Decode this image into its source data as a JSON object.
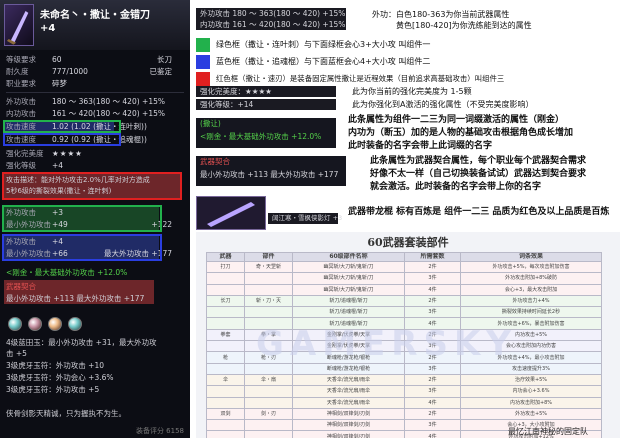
{
  "card": {
    "name": "未命名丶・撒让・金错刀",
    "level": "+4",
    "rows": [
      {
        "k": "等级要求",
        "v": "60",
        "r": "长刀"
      },
      {
        "k": "耐久度",
        "v": "777/1000",
        "r": "已鉴定"
      },
      {
        "k": "职业要求",
        "v": "碎梦",
        "r": ""
      },
      {
        "k": "外功攻击",
        "v": "180 ～ 363(180 ～ 420) +15%",
        "r": ""
      },
      {
        "k": "内功攻击",
        "v": "161 ～ 420(180 ～ 420) +15%",
        "r": ""
      },
      {
        "k": "攻击速度",
        "v": "1.02 (1.02 (撒让・连叶刺))",
        "r": ""
      },
      {
        "k": "攻击速度",
        "v": "0.92 (0.92 (撒让・追魂棍))",
        "r": ""
      },
      {
        "k": "强化完美度",
        "v": "★★★★",
        "r": ""
      },
      {
        "k": "强化等级",
        "v": "+4",
        "r": ""
      }
    ],
    "attack_note": "攻击描述：能对外功攻击2.0%几率对对方造成",
    "attack_note_2": "5秒6级的撕裂效果(撒让・连叶刺)",
    "green_block": [
      {
        "k": "外功攻击",
        "v": "+3",
        "r": ""
      },
      {
        "k": "最小外功攻击",
        "v": "+49",
        "r": "+122"
      }
    ],
    "blue_block": [
      {
        "k": "外功攻击",
        "v": "+4",
        "r": ""
      },
      {
        "k": "最小外功攻击",
        "v": "+66",
        "r": "最大外功攻击 +177"
      }
    ],
    "crest_header": "<刚金・最大基础外功攻击 +12.0%",
    "crest_label": "武器契合",
    "crest_row": "最小外功攻击 +113   最大外功攻击 +177",
    "gem_lines": [
      "4级蓝田玉：最小外功攻击 +31，最大外功攻",
      "击 +5",
      "3级虎牙玉符：外功攻击 +10",
      "3级虎牙玉符：外功会心 +3.6%",
      "3级虎牙玉符：外功攻击 +5"
    ],
    "flavor": "侠骨剑影天精诚，只为握执不为生。",
    "bottom": "装备评分 6158"
  },
  "annotations": {
    "outer_attack": "外功攻击  180 ～ 363(180 ～ 420) +15%",
    "inner_attack": "内功攻击  161 ～ 420(180 ～ 420) +15%",
    "explain_1": "外功：白色180-363为你当前武器属性",
    "explain_2": "黄色[180-420]为你洗练能到达的属性",
    "green_label": "绿色框（撒让・连叶刺）与下面绿框会心3+大小攻 叫组件一",
    "blue_label": "蓝色框（撒让・追魂棍）与下面蓝框会心4+大小攻 叫组件二",
    "red_label": "红色框（撒让・速刃）是装备固定属性撒让是近程效果（目前追求高基础攻击）叫组件三",
    "perfect_row": "强化完美度：★★★★",
    "perfect_note": "此为你当前的强化完美度为 1-5颗",
    "level_row": "强化等级：+14",
    "level_note": "此为你强化到A激活的强化属性（不受完美度影响）",
    "panel_head": "(撒让)",
    "panel_line": "<刚金・最大基础外功攻击 +12.0%",
    "mid_note_1": "此条属性为组件一二三为同一词缀激活的属性（刚金）",
    "mid_note_2": "内功为（断玉）加的是人物的基础攻击根据角色成长增加",
    "mid_note_3": "此时装备的名字会带上此词缀的名字",
    "crest_head": "武器契合",
    "crest_line": "最小外功攻击 +113   最大外功攻击 +177",
    "crest_note_1": "此条属性为武器契合属性，每个职业每个武器契合需求",
    "crest_note_2": "好像不太一样（自己切换装备试试）武器达到契合要求",
    "crest_note_3": "就会激活。此时装备的名字会带上你的名字",
    "small_tag": "阔江寒・雪枫侠影灯 +3",
    "bottom_note": "武器带龙棍 标有百炼是  组件一二三 品质为红色及以上品质是百炼",
    "caption": "最忆江南神秘的固定队",
    "colors": {
      "green": "#22b14c",
      "blue": "#2a3ee0",
      "red": "#e02020"
    }
  },
  "table": {
    "title": "60武器套装部件",
    "headers": [
      "武器",
      "部件",
      "60级部件名称",
      "所需套数",
      "词条效果"
    ],
    "rows": [
      {
        "w": "打刀",
        "p": "奇・天罡斩",
        "n": "幽冥斩/大刀斩/鬼斩/刀",
        "c": "2件",
        "e": "外功攻击+5%，每次攻击附加伤害"
      },
      {
        "w": "",
        "p": "",
        "n": "幽冥斩/大刀斩/鬼斩/刀",
        "c": "3件",
        "e": "外功攻击附加+8%破防"
      },
      {
        "w": "",
        "p": "",
        "n": "幽冥斩/大刀斩/鬼斩/刀",
        "c": "4件",
        "e": "会心+3，最大攻击附加"
      },
      {
        "w": "长刀",
        "p": "斩・刀・灭",
        "n": "斩刀/追魂棍/斩刀",
        "c": "2件",
        "e": "外功攻击力+4%"
      },
      {
        "w": "",
        "p": "",
        "n": "斩刀/追魂棍/斩刀",
        "c": "3件",
        "e": "撕裂效果持续时间延长2秒"
      },
      {
        "w": "",
        "p": "",
        "n": "斩刀/追魂棍/斩刀",
        "c": "4件",
        "e": "外功攻击+6%，暴击附加伤害"
      },
      {
        "w": "拳套",
        "p": "拳・掌",
        "n": "金刚掌/伏虎拳/天掌",
        "c": "2件",
        "e": "内功攻击+5%"
      },
      {
        "w": "",
        "p": "",
        "n": "金刚掌/伏虎拳/天掌",
        "c": "3件",
        "e": "会心攻击附加内功伤害"
      },
      {
        "w": "枪",
        "p": "枪・刃",
        "n": "断魂枪/游龙枪/银枪",
        "c": "2件",
        "e": "外功攻击+4%，最小攻击附加"
      },
      {
        "w": "",
        "p": "",
        "n": "断魂枪/游龙枪/银枪",
        "c": "3件",
        "e": "攻击速度提升3%"
      },
      {
        "w": "伞",
        "p": "伞・扇",
        "n": "天香伞/流光扇/雨伞",
        "c": "2件",
        "e": "治疗效果+5%"
      },
      {
        "w": "",
        "p": "",
        "n": "天香伞/流光扇/雨伞",
        "c": "3件",
        "e": "内功会心+3.6%"
      },
      {
        "w": "",
        "p": "",
        "n": "天香伞/流光扇/雨伞",
        "c": "4件",
        "e": "内功攻击附加+8%"
      },
      {
        "w": "双剑",
        "p": "剑・刃",
        "n": "神相剑/双锋剑/刃剑",
        "c": "2件",
        "e": "外功攻击+5%"
      },
      {
        "w": "",
        "p": "",
        "n": "神相剑/双锋剑/刃剑",
        "c": "3件",
        "e": "会心+3，大小攻附加"
      },
      {
        "w": "",
        "p": "",
        "n": "神相剑/双锋剑/刃剑",
        "c": "4件",
        "e": "外功攻击附加+12%"
      }
    ],
    "watermark": "GAMERSKY"
  }
}
